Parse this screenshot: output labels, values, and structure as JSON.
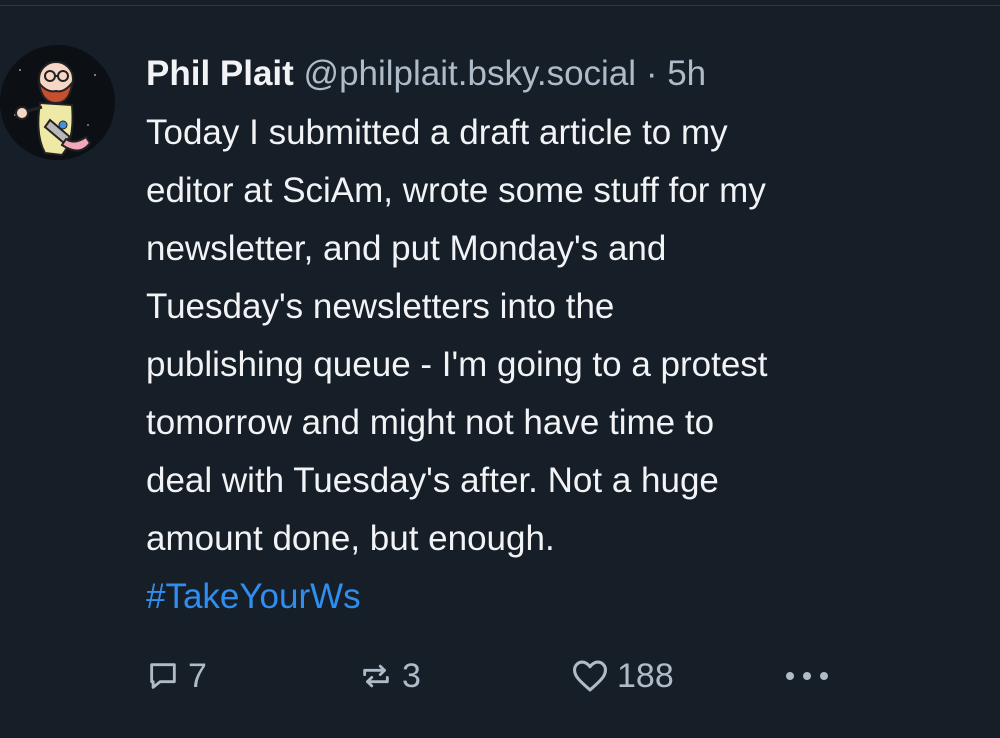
{
  "post": {
    "author_name": "Phil Plait",
    "handle": "@philplait.bsky.social",
    "separator": "·",
    "time": "5h",
    "text": "Today I submitted a draft article to my\neditor at SciAm, wrote some stuff for my\nnewsletter, and put Monday's and\nTuesday's newsletters into the\npublishing queue - I'm going to a protest\ntomorrow and might not have time to\ndeal with Tuesday's after. Not a huge\namount done, but enough.",
    "hashtag": "#TakeYourWs"
  },
  "actions": {
    "reply_icon": "reply-icon",
    "reply_count": "7",
    "repost_icon": "repost-icon",
    "repost_count": "3",
    "like_icon": "heart-icon",
    "like_count": "188",
    "more_icon": "more-options-icon"
  },
  "colors": {
    "background": "#161e27",
    "text": "#f1f3f5",
    "muted": "#aebbc9",
    "link": "#2f8ef0"
  }
}
